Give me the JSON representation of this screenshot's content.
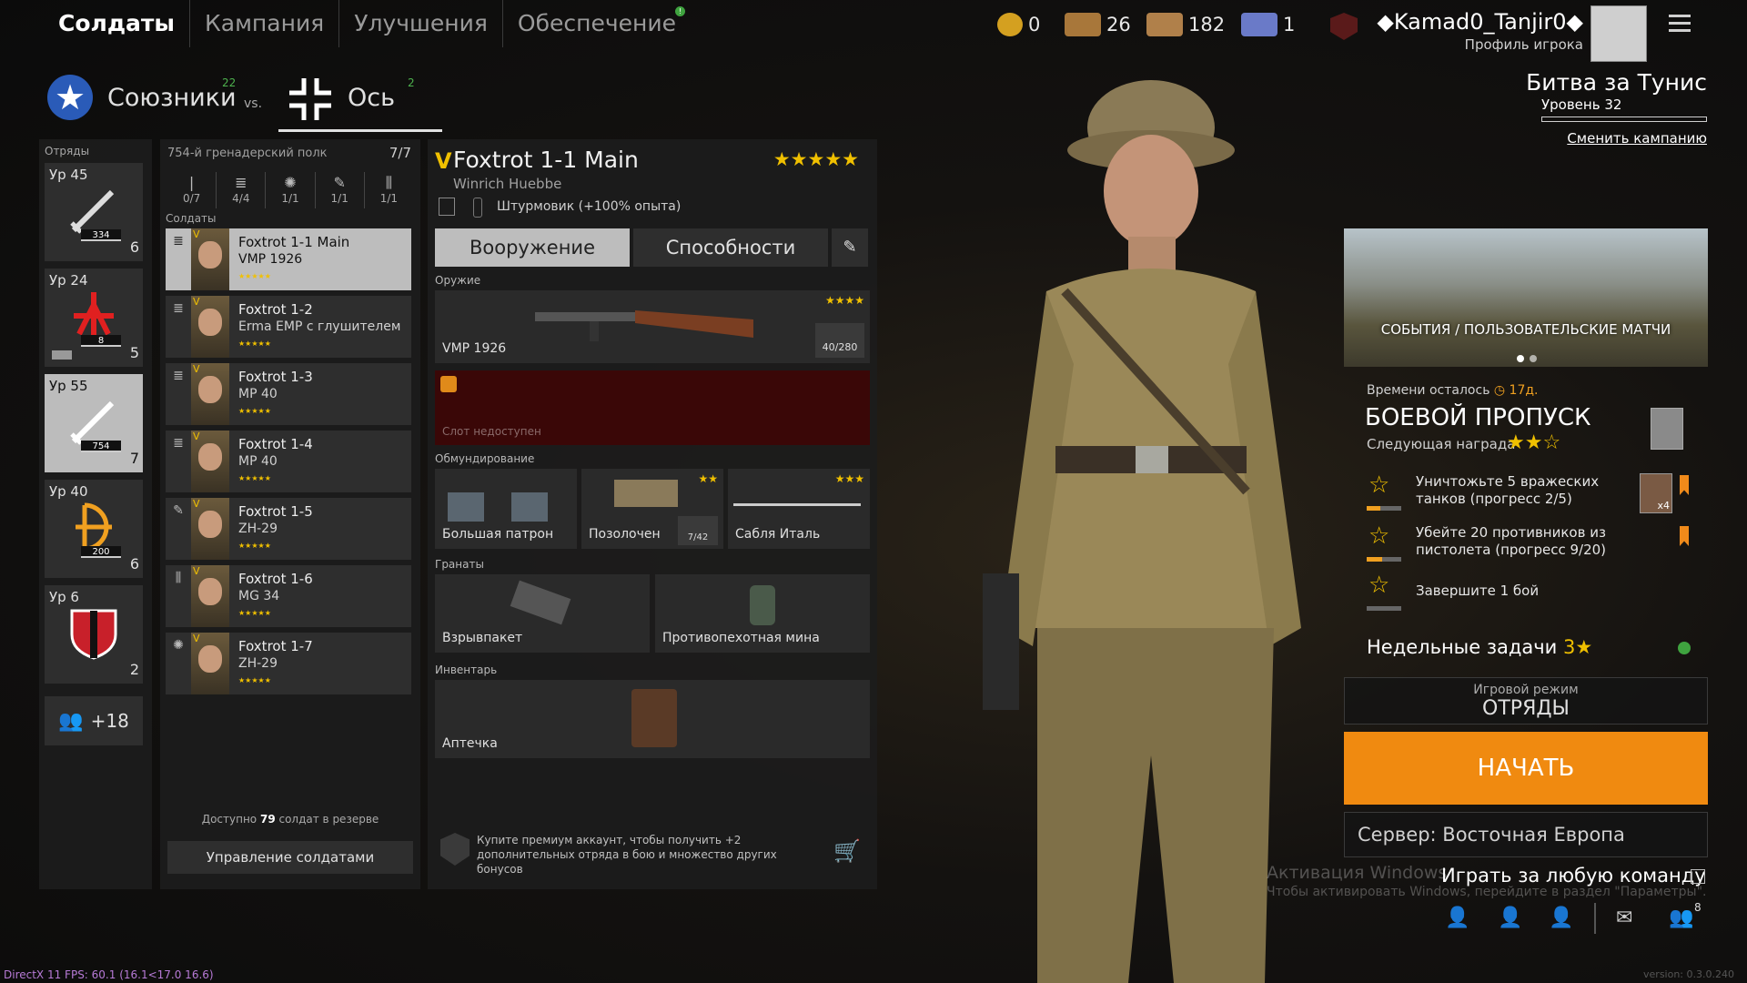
{
  "top_nav": {
    "tabs": [
      "Солдаты",
      "Кампания",
      "Улучшения",
      "Обеспечение"
    ],
    "active_index": 0,
    "supply_badge": "!"
  },
  "currency": {
    "coins": "0",
    "orders_1": "26",
    "orders_2": "182",
    "orders_3": "1"
  },
  "profile": {
    "name": "◆Kamad0_Tanjir0◆",
    "subtitle": "Профиль игрока"
  },
  "factions": {
    "allies_label": "Союзники",
    "allies_count": "22",
    "vs": "vs.",
    "axis_label": "Ось",
    "axis_count": "2"
  },
  "squads": {
    "label": "Отряды",
    "items": [
      {
        "level": "Ур 45",
        "bar": "334",
        "count": "6"
      },
      {
        "level": "Ур 24",
        "bar": "8",
        "count": "5"
      },
      {
        "level": "Ур 55",
        "bar": "754",
        "count": "7"
      },
      {
        "level": "Ур 40",
        "bar": "200",
        "count": "6"
      },
      {
        "level": "Ур 6",
        "bar": "",
        "count": "2"
      }
    ],
    "reserve": "+18"
  },
  "soldiers_panel": {
    "regiment": "754-й гренадерский полк",
    "regiment_count": "7/7",
    "slots": [
      "0/7",
      "4/4",
      "1/1",
      "1/1",
      "1/1"
    ],
    "label": "Солдаты",
    "list": [
      {
        "name": "Foxtrot 1-1 Main",
        "weapon": "VMP 1926"
      },
      {
        "name": "Foxtrot 1-2",
        "weapon": "Erma EMP с глушителем"
      },
      {
        "name": "Foxtrot 1-3",
        "weapon": "MP 40"
      },
      {
        "name": "Foxtrot 1-4",
        "weapon": "MP 40"
      },
      {
        "name": "Foxtrot 1-5",
        "weapon": "ZH-29"
      },
      {
        "name": "Foxtrot 1-6",
        "weapon": "MG 34"
      },
      {
        "name": "Foxtrot 1-7",
        "weapon": "ZH-29"
      }
    ],
    "stars": "★★★★★",
    "reserve_prefix": "Доступно ",
    "reserve_count": "79",
    "reserve_suffix": " солдат в резерве",
    "manage_button": "Управление солдатами"
  },
  "loadout": {
    "rank_mark": "V",
    "title": "Foxtrot 1-1 Main",
    "subtitle": "Winrich Huebbe",
    "stars": "★★★★★",
    "class": "Штурмовик  (+100% опыта)",
    "tab_weapons": "Вооружение",
    "tab_abilities": "Способности",
    "edit_icon": "✎",
    "weapons_label": "Оружие",
    "primary": {
      "name": "VMP 1926",
      "stars": "★★★★",
      "ammo": "40/280"
    },
    "locked_slot": "Слот недоступен",
    "equipment_label": "Обмундирование",
    "equipment": [
      {
        "name": "Большая патрон",
        "stars": ""
      },
      {
        "name": "Позолочен",
        "stars": "★★",
        "ammo": "7/42"
      },
      {
        "name": "Сабля Италь",
        "stars": "★★★"
      }
    ],
    "grenades_label": "Гранаты",
    "grenades": [
      "Взрывпакет",
      "Противопехотная мина"
    ],
    "inventory_label": "Инвентарь",
    "inventory": [
      "Аптечка"
    ],
    "premium_text": "Купите премиум аккаунт, чтобы получить +2 дополнительных отряда в бою и множество других бонусов"
  },
  "campaign": {
    "title": "Битва за Тунис",
    "level": "Уровень 32",
    "change_link": "Сменить кампанию"
  },
  "events": {
    "label": "СОБЫТИЯ / ПОЛЬЗОВАТЕЛЬСКИЕ МАТЧИ"
  },
  "battle_pass": {
    "time_label": "Времени осталось ",
    "time_value": "◷ 17д.",
    "title": "БОЕВОЙ ПРОПУСК",
    "next_reward": "Следующая награда",
    "next_stars": "★★☆",
    "tasks": [
      {
        "text": "Уничтожьте 5 вражеских танков (прогресс 2/5)",
        "progress": 0.4,
        "reward": "x4"
      },
      {
        "text": "Убейте 20 противников из пистолета (прогресс 9/20)",
        "progress": 0.45
      },
      {
        "text": "Завершите 1 бой",
        "progress": 0
      }
    ]
  },
  "weekly": {
    "label": "Недельные задачи ",
    "count": "3★"
  },
  "game_mode": {
    "label": "Игровой режим",
    "value": "ОТРЯДЫ"
  },
  "start_button": "НАЧАТЬ",
  "server": "Сервер: Восточная Европа",
  "any_team": "Играть за любую команду",
  "windows_activation": {
    "title": "Активация Windows",
    "subtitle": "Чтобы активировать Windows, перейдите в раздел \"Параметры\"."
  },
  "friends_count": "8",
  "fps": "DirectX 11 FPS: 60.1 (16.1<17.0 16.6)",
  "version": "version: 0.3.0.240",
  "colors": {
    "accent_orange": "#f08a10",
    "star_gold": "#f0c000",
    "locked_red": "#3a0707",
    "badge_green": "#3fa33f"
  }
}
